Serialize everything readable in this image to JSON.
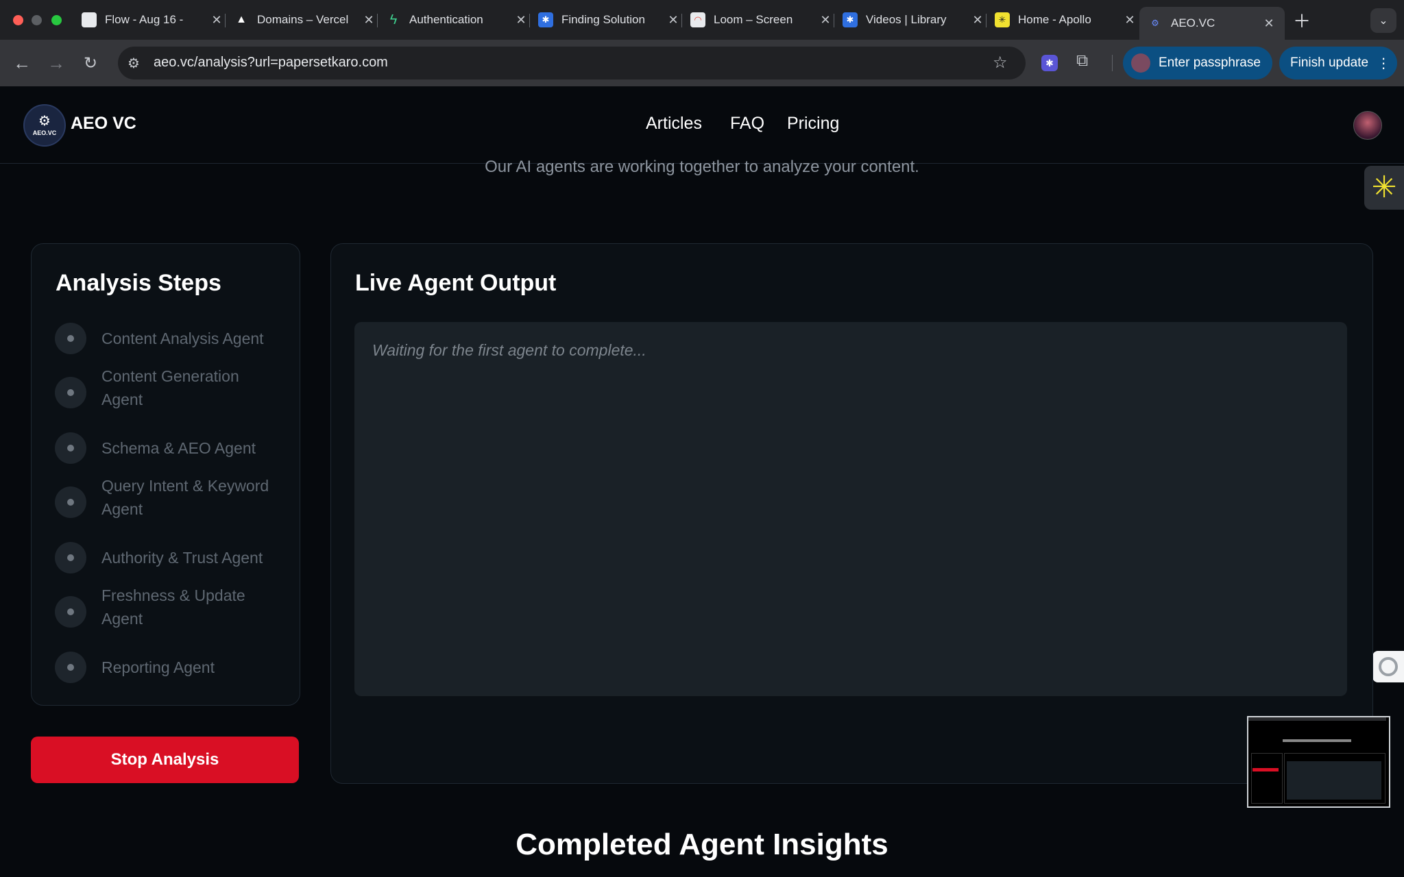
{
  "browser": {
    "tabs": [
      {
        "title": "Flow - Aug 16 - ",
        "favicon": "document-icon",
        "color": "#e8eaed"
      },
      {
        "title": "Domains – Vercel",
        "favicon": "vercel-triangle-icon",
        "color": "#ffffff"
      },
      {
        "title": "Authentication",
        "favicon": "bolt-icon",
        "color": "#3ecf8e"
      },
      {
        "title": "Finding Solution",
        "favicon": "gear-badge-icon",
        "color": "#2f6fe0"
      },
      {
        "title": "Loom – Screen",
        "favicon": "loom-icon",
        "color": "#e8eaed"
      },
      {
        "title": "Videos | Library",
        "favicon": "gear-badge-icon",
        "color": "#2f6fe0"
      },
      {
        "title": "Home - Apollo",
        "favicon": "apollo-icon",
        "color": "#f0e130"
      },
      {
        "title": "AEO.VC",
        "favicon": "aeo-icon",
        "color": "#6a8cff"
      }
    ],
    "url": "aeo.vc/analysis?url=papersetkaro.com",
    "passphrase_label": "Enter passphrase",
    "finish_update_label": "Finish update"
  },
  "site": {
    "brand": "AEO VC",
    "logo_text": "AEO.VC",
    "nav": [
      "Articles",
      "FAQ",
      "Pricing"
    ]
  },
  "intro_text": "Our AI agents are working together to analyze your content.",
  "steps_card": {
    "title": "Analysis Steps",
    "steps": [
      "Content Analysis Agent",
      "Content Generation Agent",
      "Schema & AEO Agent",
      "Query Intent & Keyword Agent",
      "Authority & Trust Agent",
      "Freshness & Update Agent",
      "Reporting Agent"
    ]
  },
  "stop_button": "Stop Analysis",
  "output_card": {
    "title": "Live Agent Output",
    "placeholder": "Waiting for the first agent to complete..."
  },
  "insights_title": "Completed Agent Insights",
  "colors": {
    "accent_red": "#d90f24",
    "page_bg": "#06090d",
    "chrome_pill": "#0b4f82"
  }
}
